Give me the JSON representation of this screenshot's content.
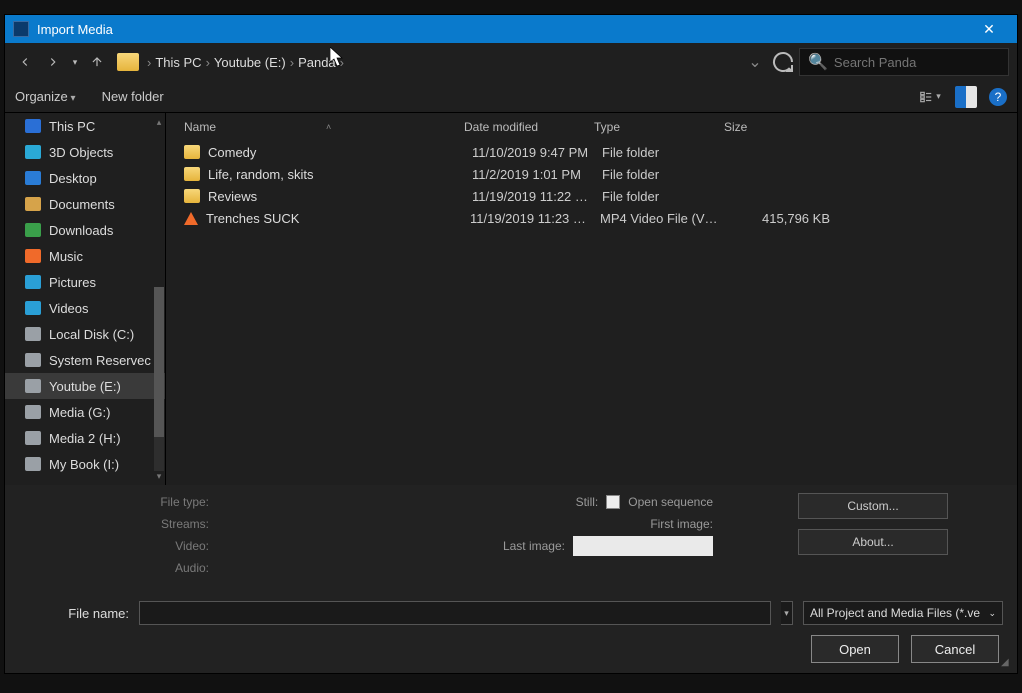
{
  "window": {
    "title": "Import Media"
  },
  "nav": {
    "crumbs": [
      "This PC",
      "Youtube (E:)",
      "Panda"
    ],
    "search_placeholder": "Search Panda"
  },
  "toolbar": {
    "organize": "Organize",
    "newfolder": "New folder",
    "help": "?"
  },
  "tree": [
    {
      "label": "This PC",
      "icon": "pc"
    },
    {
      "label": "3D Objects",
      "icon": "obj3d"
    },
    {
      "label": "Desktop",
      "icon": "desktop"
    },
    {
      "label": "Documents",
      "icon": "docs"
    },
    {
      "label": "Downloads",
      "icon": "downloads"
    },
    {
      "label": "Music",
      "icon": "music"
    },
    {
      "label": "Pictures",
      "icon": "pictures"
    },
    {
      "label": "Videos",
      "icon": "videos"
    },
    {
      "label": "Local Disk (C:)",
      "icon": "disk"
    },
    {
      "label": "System Reservec",
      "icon": "disk"
    },
    {
      "label": "Youtube (E:)",
      "icon": "disk",
      "selected": true
    },
    {
      "label": "Media (G:)",
      "icon": "disk"
    },
    {
      "label": "Media 2 (H:)",
      "icon": "disk"
    },
    {
      "label": "My Book (I:)",
      "icon": "disk"
    }
  ],
  "columns": {
    "name": "Name",
    "date": "Date modified",
    "type": "Type",
    "size": "Size"
  },
  "files": [
    {
      "name": "Comedy",
      "date": "11/10/2019 9:47 PM",
      "type": "File folder",
      "size": "",
      "icon": "folder"
    },
    {
      "name": "Life, random, skits",
      "date": "11/2/2019 1:01 PM",
      "type": "File folder",
      "size": "",
      "icon": "folder"
    },
    {
      "name": "Reviews",
      "date": "11/19/2019 11:22 …",
      "type": "File folder",
      "size": "",
      "icon": "folder"
    },
    {
      "name": "Trenches SUCK",
      "date": "11/19/2019 11:23 …",
      "type": "MP4 Video File (V…",
      "size": "415,796 KB",
      "icon": "vlc"
    }
  ],
  "meta": {
    "file_type": "File type:",
    "streams": "Streams:",
    "video": "Video:",
    "audio": "Audio:",
    "still": "Still:",
    "open_sequence": "Open sequence",
    "first_image": "First image:",
    "last_image": "Last image:",
    "custom": "Custom...",
    "about": "About..."
  },
  "bottom": {
    "file_name_label": "File name:",
    "file_name_value": "",
    "filter": "All Project and Media Files (*.ve",
    "open": "Open",
    "cancel": "Cancel"
  }
}
